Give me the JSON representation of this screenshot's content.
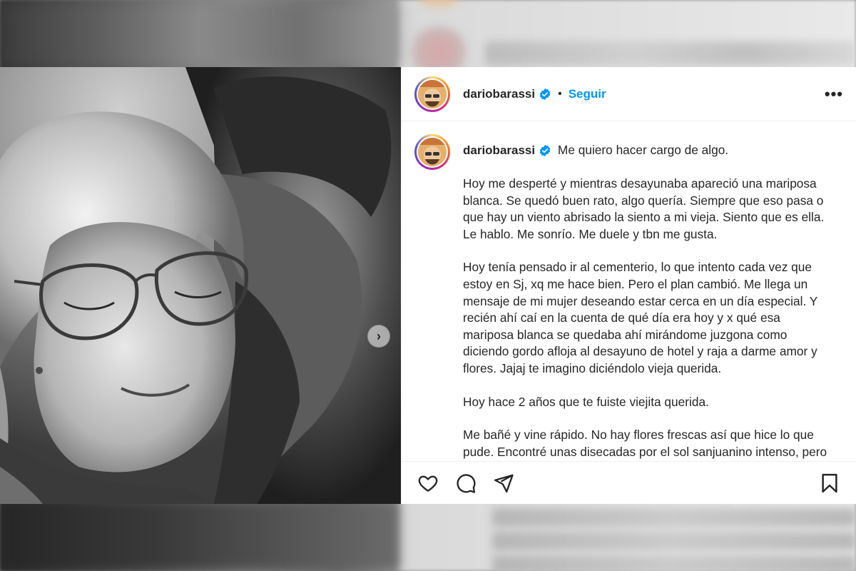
{
  "post": {
    "author": {
      "username": "dariobarassi",
      "verified": true
    },
    "follow_label": "Seguir",
    "separator": "•",
    "more_label": "•••",
    "carousel_next": "›",
    "caption": {
      "first_line": "Me quiero hacer cargo de algo.",
      "paragraphs": [
        "Hoy me desperté y mientras desayunaba apareció una mariposa blanca. Se quedó buen rato, algo quería. Siempre que eso pasa o que hay un viento abrisado la siento a mi vieja. Siento que es ella. Le hablo. Me sonrío. Me duele y tbn me gusta.",
        "Hoy tenía pensado ir al cementerio, lo que intento cada vez que estoy en Sj, xq me hace bien. Pero el plan cambió. Me llega un mensaje de mi mujer deseando estar cerca en un día especial. Y recién ahí caí en la cuenta de qué día era hoy y x qué esa mariposa blanca se quedaba ahí mirándome juzgona como diciendo gordo afloja al desayuno de hotel y raja a darme amor y flores. Jajaj te imagino diciéndolo vieja querida.",
        "Hoy hace 2 años que te fuiste viejita querida.",
        "Me bañé y vine rápido. No hay flores frescas así que hice lo que pude. Encontré unas disecadas por el sol sanjuanino intenso, pero a vos te encantaba secar flores bordo y hacer ese popurrí"
      ]
    },
    "actions": [
      "heart-icon",
      "comment-icon",
      "share-icon",
      "bookmark-icon"
    ],
    "colors": {
      "accent": "#0095f6",
      "text": "#262626"
    }
  }
}
